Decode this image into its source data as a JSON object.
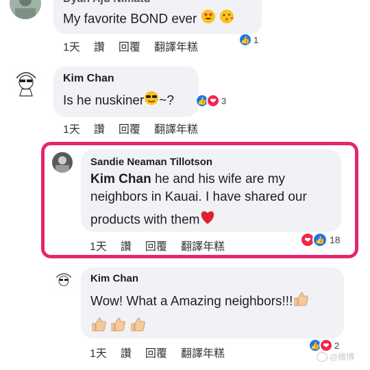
{
  "comments": [
    {
      "name": "Dyan Aju Nimatu",
      "text": "My favorite BOND ever",
      "actions": [
        "1天",
        "讚",
        "回覆",
        "翻譯年糕"
      ],
      "reaction_count": "1"
    },
    {
      "name": "Kim Chan",
      "text_before": "Is he nuskiner",
      "text_after": "~?",
      "actions": [
        "1天",
        "讚",
        "回覆",
        "翻譯年糕"
      ],
      "reaction_count": "3"
    },
    {
      "name": "Sandie Neaman Tillotson",
      "mention": "Kim Chan",
      "line1_rest": " he and his wife are my",
      "line2": "neighbors in Kauai.  I have shared our",
      "line3": "products with them",
      "actions": [
        "1天",
        "讚",
        "回覆",
        "翻譯年糕"
      ],
      "reaction_count": "18"
    },
    {
      "name": "Kim Chan",
      "text": "Wow! What a Amazing neighbors!!!",
      "actions": [
        "1天",
        "讚",
        "回覆",
        "翻譯年糕"
      ],
      "reaction_count": "2"
    }
  ],
  "watermark": "@微博",
  "colors": {
    "highlight": "#e5256f",
    "like": "#1877f2",
    "love": "#f0284a",
    "bubble": "#f0f2f5"
  }
}
